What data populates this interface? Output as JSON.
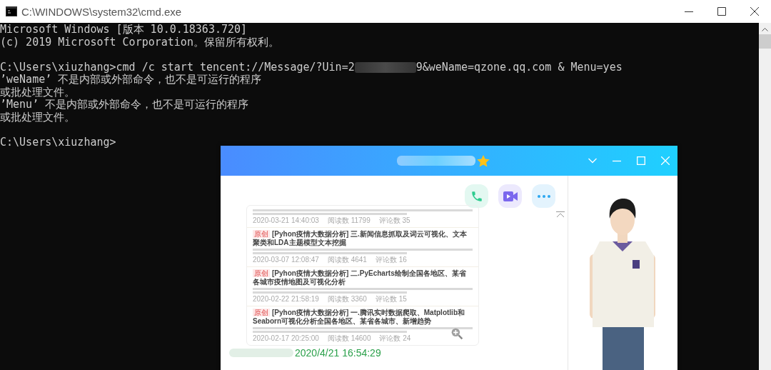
{
  "console_window": {
    "title": "C:\\WINDOWS\\system32\\cmd.exe",
    "lines": [
      {
        "text": "Microsoft Windows [版本 10.0.18363.720]",
        "gap_before": false,
        "redacted": false
      },
      {
        "text": "(c) 2019 Microsoft Corporation。保留所有权利。",
        "gap_before": false,
        "redacted": false
      },
      {
        "text": "C:\\Users\\xiuzhang>cmd /c start tencent://Message/?Uin=2",
        "gap_before": true,
        "redacted": true,
        "text_after": "9&weName=qzone.qq.com & Menu=yes"
      },
      {
        "text": "’weName’ 不是内部或外部命令，也不是可运行的程序",
        "gap_before": false,
        "redacted": false
      },
      {
        "text": "或批处理文件。",
        "gap_before": false,
        "redacted": false
      },
      {
        "text": "’Menu’ 不是内部或外部命令，也不是可运行的程序",
        "gap_before": false,
        "redacted": false
      },
      {
        "text": "或批处理文件。",
        "gap_before": false,
        "redacted": false
      },
      {
        "text": "C:\\Users\\xiuzhang>",
        "gap_before": true,
        "redacted": false
      }
    ]
  },
  "chat_window": {
    "shared_image": {
      "articles": [
        {
          "meta": [
            "2020-03-21 14:40:03",
            "阅读数 11799",
            "评论数 35"
          ]
        },
        {
          "badge": "原创",
          "title": "[Pyhon疫情大数据分析] 三.新闻信息抓取及词云可视化、文本聚类和LDA主题模型文本挖掘",
          "meta": [
            "2020-03-07 12:08:47",
            "阅读数 4641",
            "评论数 16"
          ]
        },
        {
          "badge": "原创",
          "title": "[Pyhon疫情大数据分析] 二.PyEcharts绘制全国各地区、某省各城市疫情地图及可视化分析",
          "meta": [
            "2020-02-22 21:58:19",
            "阅读数 3360",
            "评论数 15"
          ]
        },
        {
          "badge": "原创",
          "title": "[Pyhon疫情大数据分析] 一.腾讯实时数据爬取、Matplotlib和Seaborn可视化分析全国各地区、某省各城市、新增趋势",
          "meta": [
            "2020-02-17 20:25:00",
            "阅读数 14600",
            "评论数 24"
          ]
        }
      ]
    },
    "message_time": "2020/4/21 16:54:29"
  }
}
